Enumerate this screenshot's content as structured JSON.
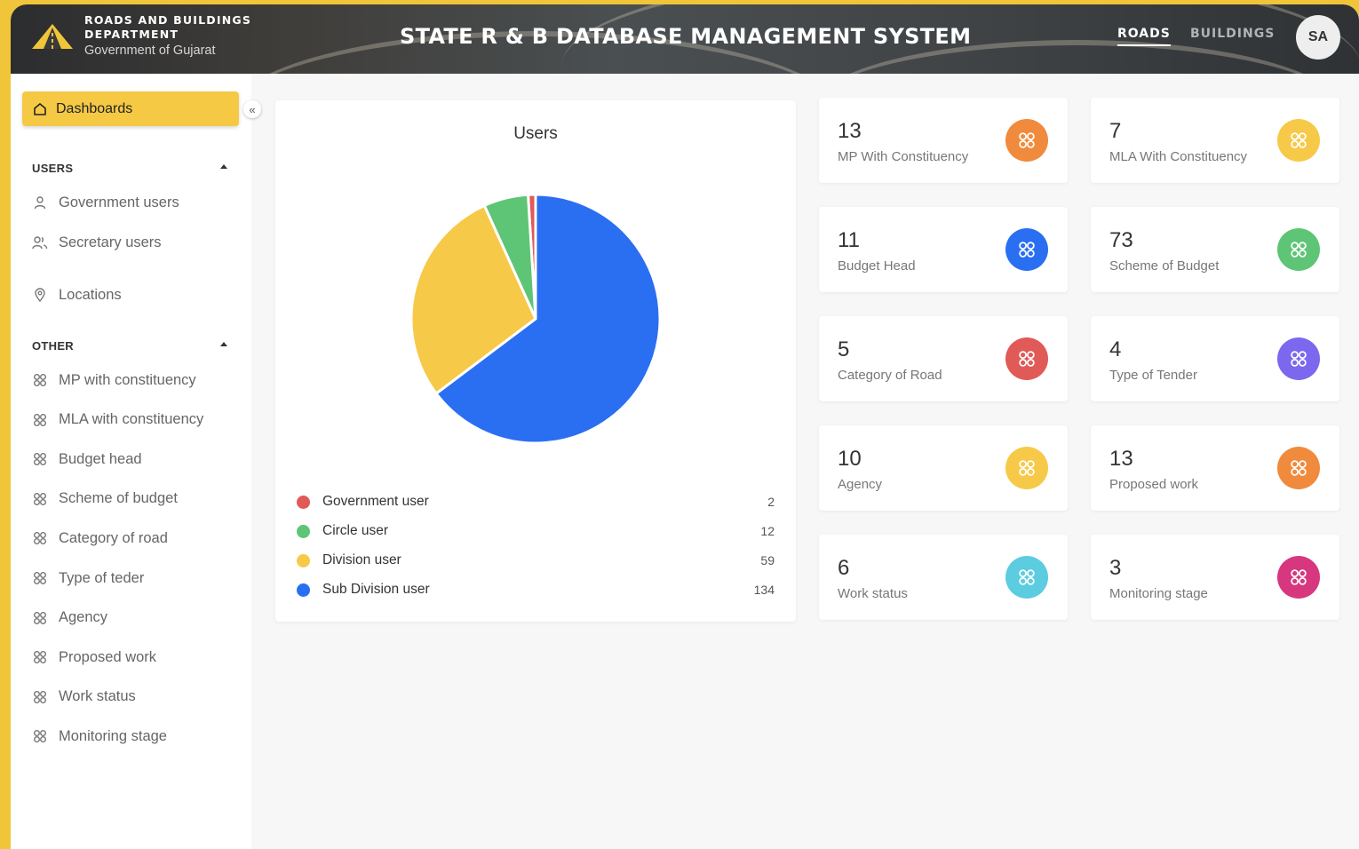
{
  "header": {
    "dept_line1": "ROADS AND BUILDINGS",
    "dept_line2": "DEPARTMENT",
    "dept_line3": "Government of Gujarat",
    "app_title": "STATE R & B DATABASE MANAGEMENT SYSTEM",
    "nav": [
      {
        "label": "ROADS",
        "active": true
      },
      {
        "label": "BUILDINGS",
        "active": false
      }
    ],
    "avatar_initials": "SA"
  },
  "sidebar": {
    "dashboard_label": "Dashboards",
    "collapse_glyph": "«",
    "users_section": {
      "title": "USERS",
      "items": [
        {
          "label": "Government users",
          "icon": "user-icon"
        },
        {
          "label": "Secretary users",
          "icon": "users-icon"
        },
        {
          "label": "Locations",
          "icon": "location-pin-icon"
        }
      ]
    },
    "other_section": {
      "title": "OTHER",
      "items": [
        {
          "label": "MP with constituency",
          "icon": "grid-icon"
        },
        {
          "label": "MLA with constituency",
          "icon": "grid-icon"
        },
        {
          "label": "Budget head",
          "icon": "grid-icon"
        },
        {
          "label": "Scheme of budget",
          "icon": "grid-icon"
        },
        {
          "label": "Category of road",
          "icon": "grid-icon"
        },
        {
          "label": "Type of teder",
          "icon": "grid-icon"
        },
        {
          "label": "Agency",
          "icon": "grid-icon"
        },
        {
          "label": "Proposed work",
          "icon": "grid-icon"
        },
        {
          "label": "Work status",
          "icon": "grid-icon"
        },
        {
          "label": "Monitoring stage",
          "icon": "grid-icon"
        }
      ]
    }
  },
  "chart_data": {
    "type": "pie",
    "title": "Users",
    "categories": [
      "Government user",
      "Circle user",
      "Division user",
      "Sub Division user"
    ],
    "values": [
      2,
      12,
      59,
      134
    ],
    "colors": [
      "#e05a58",
      "#5ec576",
      "#f7c948",
      "#2a6ff2"
    ],
    "legend": "bottom"
  },
  "stats": [
    {
      "value": "13",
      "label": "MP With Constituency",
      "color": "#f08a3c"
    },
    {
      "value": "7",
      "label": "MLA With Constituency",
      "color": "#f7c948"
    },
    {
      "value": "11",
      "label": "Budget Head",
      "color": "#2a6ff2"
    },
    {
      "value": "73",
      "label": "Scheme of Budget",
      "color": "#5ec576"
    },
    {
      "value": "5",
      "label": "Category of Road",
      "color": "#e05a58"
    },
    {
      "value": "4",
      "label": "Type of Tender",
      "color": "#7b68ee"
    },
    {
      "value": "10",
      "label": "Agency",
      "color": "#f7c948"
    },
    {
      "value": "13",
      "label": "Proposed work",
      "color": "#f08a3c"
    },
    {
      "value": "6",
      "label": "Work status",
      "color": "#5ccce0"
    },
    {
      "value": "3",
      "label": "Monitoring stage",
      "color": "#d6377f"
    }
  ]
}
